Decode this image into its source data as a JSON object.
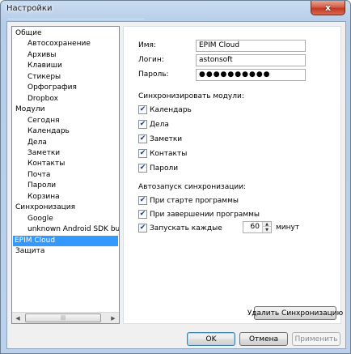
{
  "window": {
    "title": "Настройки",
    "close_glyph": "x"
  },
  "tree": {
    "items": [
      {
        "label": "Общие",
        "level": 0,
        "selected": false
      },
      {
        "label": "Автосохранение",
        "level": 1,
        "selected": false
      },
      {
        "label": "Архивы",
        "level": 1,
        "selected": false
      },
      {
        "label": "Клавиши",
        "level": 1,
        "selected": false
      },
      {
        "label": "Стикеры",
        "level": 1,
        "selected": false
      },
      {
        "label": "Орфография",
        "level": 1,
        "selected": false
      },
      {
        "label": "Dropbox",
        "level": 1,
        "selected": false
      },
      {
        "label": "Модули",
        "level": 0,
        "selected": false
      },
      {
        "label": "Сегодня",
        "level": 1,
        "selected": false
      },
      {
        "label": "Календарь",
        "level": 1,
        "selected": false
      },
      {
        "label": "Дела",
        "level": 1,
        "selected": false
      },
      {
        "label": "Заметки",
        "level": 1,
        "selected": false
      },
      {
        "label": "Контакты",
        "level": 1,
        "selected": false
      },
      {
        "label": "Почта",
        "level": 1,
        "selected": false
      },
      {
        "label": "Пароли",
        "level": 1,
        "selected": false
      },
      {
        "label": "Корзина",
        "level": 1,
        "selected": false
      },
      {
        "label": "Синхронизация",
        "level": 0,
        "selected": false
      },
      {
        "label": "Google",
        "level": 1,
        "selected": false
      },
      {
        "label": "unknown Android SDK bu",
        "level": 1,
        "selected": false
      },
      {
        "label": "EPIM Cloud",
        "level": 0,
        "selected": true
      },
      {
        "label": "Защита",
        "level": 0,
        "selected": false
      }
    ],
    "scroll_left": "◀",
    "scroll_right": "▶",
    "scroll_grip": "|||"
  },
  "account": {
    "name_label": "Имя:",
    "name_value": "EPIM Cloud",
    "login_label": "Логин:",
    "login_value": "astonsoft",
    "password_label": "Пароль:",
    "password_value": "●●●●●●●●●●"
  },
  "sync_modules": {
    "heading": "Синхронизировать модули:",
    "items": [
      {
        "label": "Календарь",
        "checked": true
      },
      {
        "label": "Дела",
        "checked": true
      },
      {
        "label": "Заметки",
        "checked": true
      },
      {
        "label": "Контакты",
        "checked": true
      },
      {
        "label": "Пароли",
        "checked": true
      }
    ]
  },
  "autostart": {
    "heading": "Автозапуск синхронизации:",
    "on_start_label": "При старте программы",
    "on_start_checked": true,
    "on_exit_label": "При завершении программы",
    "on_exit_checked": true,
    "every_label": "Запускать каждые",
    "every_checked": true,
    "every_value": "60",
    "every_unit": "минут"
  },
  "delete_sync_button": "Удалить Синхронизацию",
  "buttons": {
    "ok": "OK",
    "cancel": "Отмена",
    "apply": "Применить"
  },
  "check_glyph": "✔",
  "spin_up": "▲",
  "spin_down": "▼"
}
